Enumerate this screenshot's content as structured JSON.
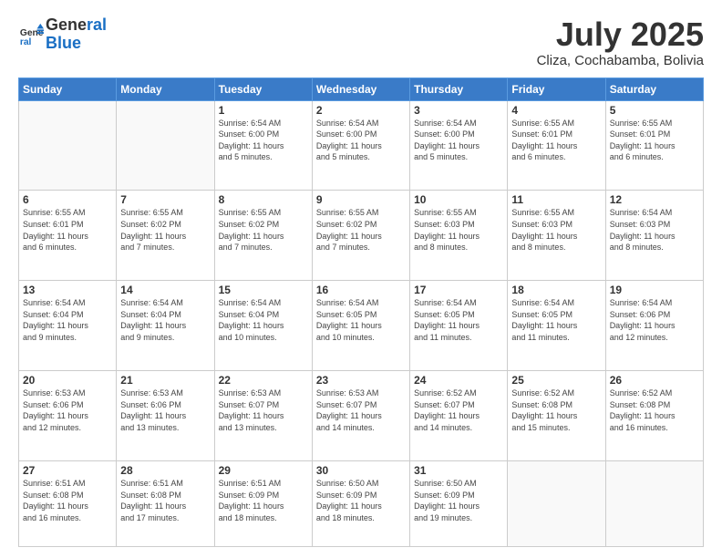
{
  "header": {
    "logo_line1": "General",
    "logo_line2": "Blue",
    "month": "July 2025",
    "location": "Cliza, Cochabamba, Bolivia"
  },
  "weekdays": [
    "Sunday",
    "Monday",
    "Tuesday",
    "Wednesday",
    "Thursday",
    "Friday",
    "Saturday"
  ],
  "weeks": [
    [
      {
        "day": "",
        "info": ""
      },
      {
        "day": "",
        "info": ""
      },
      {
        "day": "1",
        "info": "Sunrise: 6:54 AM\nSunset: 6:00 PM\nDaylight: 11 hours\nand 5 minutes."
      },
      {
        "day": "2",
        "info": "Sunrise: 6:54 AM\nSunset: 6:00 PM\nDaylight: 11 hours\nand 5 minutes."
      },
      {
        "day": "3",
        "info": "Sunrise: 6:54 AM\nSunset: 6:00 PM\nDaylight: 11 hours\nand 5 minutes."
      },
      {
        "day": "4",
        "info": "Sunrise: 6:55 AM\nSunset: 6:01 PM\nDaylight: 11 hours\nand 6 minutes."
      },
      {
        "day": "5",
        "info": "Sunrise: 6:55 AM\nSunset: 6:01 PM\nDaylight: 11 hours\nand 6 minutes."
      }
    ],
    [
      {
        "day": "6",
        "info": "Sunrise: 6:55 AM\nSunset: 6:01 PM\nDaylight: 11 hours\nand 6 minutes."
      },
      {
        "day": "7",
        "info": "Sunrise: 6:55 AM\nSunset: 6:02 PM\nDaylight: 11 hours\nand 7 minutes."
      },
      {
        "day": "8",
        "info": "Sunrise: 6:55 AM\nSunset: 6:02 PM\nDaylight: 11 hours\nand 7 minutes."
      },
      {
        "day": "9",
        "info": "Sunrise: 6:55 AM\nSunset: 6:02 PM\nDaylight: 11 hours\nand 7 minutes."
      },
      {
        "day": "10",
        "info": "Sunrise: 6:55 AM\nSunset: 6:03 PM\nDaylight: 11 hours\nand 8 minutes."
      },
      {
        "day": "11",
        "info": "Sunrise: 6:55 AM\nSunset: 6:03 PM\nDaylight: 11 hours\nand 8 minutes."
      },
      {
        "day": "12",
        "info": "Sunrise: 6:54 AM\nSunset: 6:03 PM\nDaylight: 11 hours\nand 8 minutes."
      }
    ],
    [
      {
        "day": "13",
        "info": "Sunrise: 6:54 AM\nSunset: 6:04 PM\nDaylight: 11 hours\nand 9 minutes."
      },
      {
        "day": "14",
        "info": "Sunrise: 6:54 AM\nSunset: 6:04 PM\nDaylight: 11 hours\nand 9 minutes."
      },
      {
        "day": "15",
        "info": "Sunrise: 6:54 AM\nSunset: 6:04 PM\nDaylight: 11 hours\nand 10 minutes."
      },
      {
        "day": "16",
        "info": "Sunrise: 6:54 AM\nSunset: 6:05 PM\nDaylight: 11 hours\nand 10 minutes."
      },
      {
        "day": "17",
        "info": "Sunrise: 6:54 AM\nSunset: 6:05 PM\nDaylight: 11 hours\nand 11 minutes."
      },
      {
        "day": "18",
        "info": "Sunrise: 6:54 AM\nSunset: 6:05 PM\nDaylight: 11 hours\nand 11 minutes."
      },
      {
        "day": "19",
        "info": "Sunrise: 6:54 AM\nSunset: 6:06 PM\nDaylight: 11 hours\nand 12 minutes."
      }
    ],
    [
      {
        "day": "20",
        "info": "Sunrise: 6:53 AM\nSunset: 6:06 PM\nDaylight: 11 hours\nand 12 minutes."
      },
      {
        "day": "21",
        "info": "Sunrise: 6:53 AM\nSunset: 6:06 PM\nDaylight: 11 hours\nand 13 minutes."
      },
      {
        "day": "22",
        "info": "Sunrise: 6:53 AM\nSunset: 6:07 PM\nDaylight: 11 hours\nand 13 minutes."
      },
      {
        "day": "23",
        "info": "Sunrise: 6:53 AM\nSunset: 6:07 PM\nDaylight: 11 hours\nand 14 minutes."
      },
      {
        "day": "24",
        "info": "Sunrise: 6:52 AM\nSunset: 6:07 PM\nDaylight: 11 hours\nand 14 minutes."
      },
      {
        "day": "25",
        "info": "Sunrise: 6:52 AM\nSunset: 6:08 PM\nDaylight: 11 hours\nand 15 minutes."
      },
      {
        "day": "26",
        "info": "Sunrise: 6:52 AM\nSunset: 6:08 PM\nDaylight: 11 hours\nand 16 minutes."
      }
    ],
    [
      {
        "day": "27",
        "info": "Sunrise: 6:51 AM\nSunset: 6:08 PM\nDaylight: 11 hours\nand 16 minutes."
      },
      {
        "day": "28",
        "info": "Sunrise: 6:51 AM\nSunset: 6:08 PM\nDaylight: 11 hours\nand 17 minutes."
      },
      {
        "day": "29",
        "info": "Sunrise: 6:51 AM\nSunset: 6:09 PM\nDaylight: 11 hours\nand 18 minutes."
      },
      {
        "day": "30",
        "info": "Sunrise: 6:50 AM\nSunset: 6:09 PM\nDaylight: 11 hours\nand 18 minutes."
      },
      {
        "day": "31",
        "info": "Sunrise: 6:50 AM\nSunset: 6:09 PM\nDaylight: 11 hours\nand 19 minutes."
      },
      {
        "day": "",
        "info": ""
      },
      {
        "day": "",
        "info": ""
      }
    ]
  ]
}
